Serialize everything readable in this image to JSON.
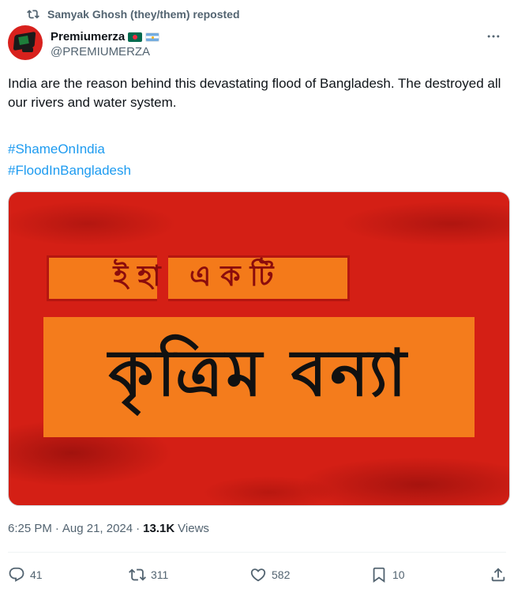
{
  "repost": {
    "text": "Samyak Ghosh (they/them) reposted"
  },
  "author": {
    "display_name": "Premiumerza",
    "handle": "@PREMIUMERZA"
  },
  "tweet": {
    "text": "India are the reason behind this devastating flood of Bangladesh. The destroyed all our rivers and water system.",
    "hashtags": [
      "#ShameOnIndia",
      "#FloodInBangladesh"
    ]
  },
  "media": {
    "top_text": "ইহা একটি",
    "main_text": "কৃত্রিম বন্যা"
  },
  "meta": {
    "time": "6:25 PM",
    "separator1": "·",
    "date": "Aug 21, 2024",
    "separator2": "·",
    "views_count": "13.1K",
    "views_label": "Views"
  },
  "actions": {
    "replies": "41",
    "reposts": "311",
    "likes": "582",
    "bookmarks": "10"
  },
  "colors": {
    "accent": "#1d9bf0",
    "secondary_text": "#536471",
    "banner_red": "#d41f15",
    "banner_orange": "#f47c1c"
  }
}
